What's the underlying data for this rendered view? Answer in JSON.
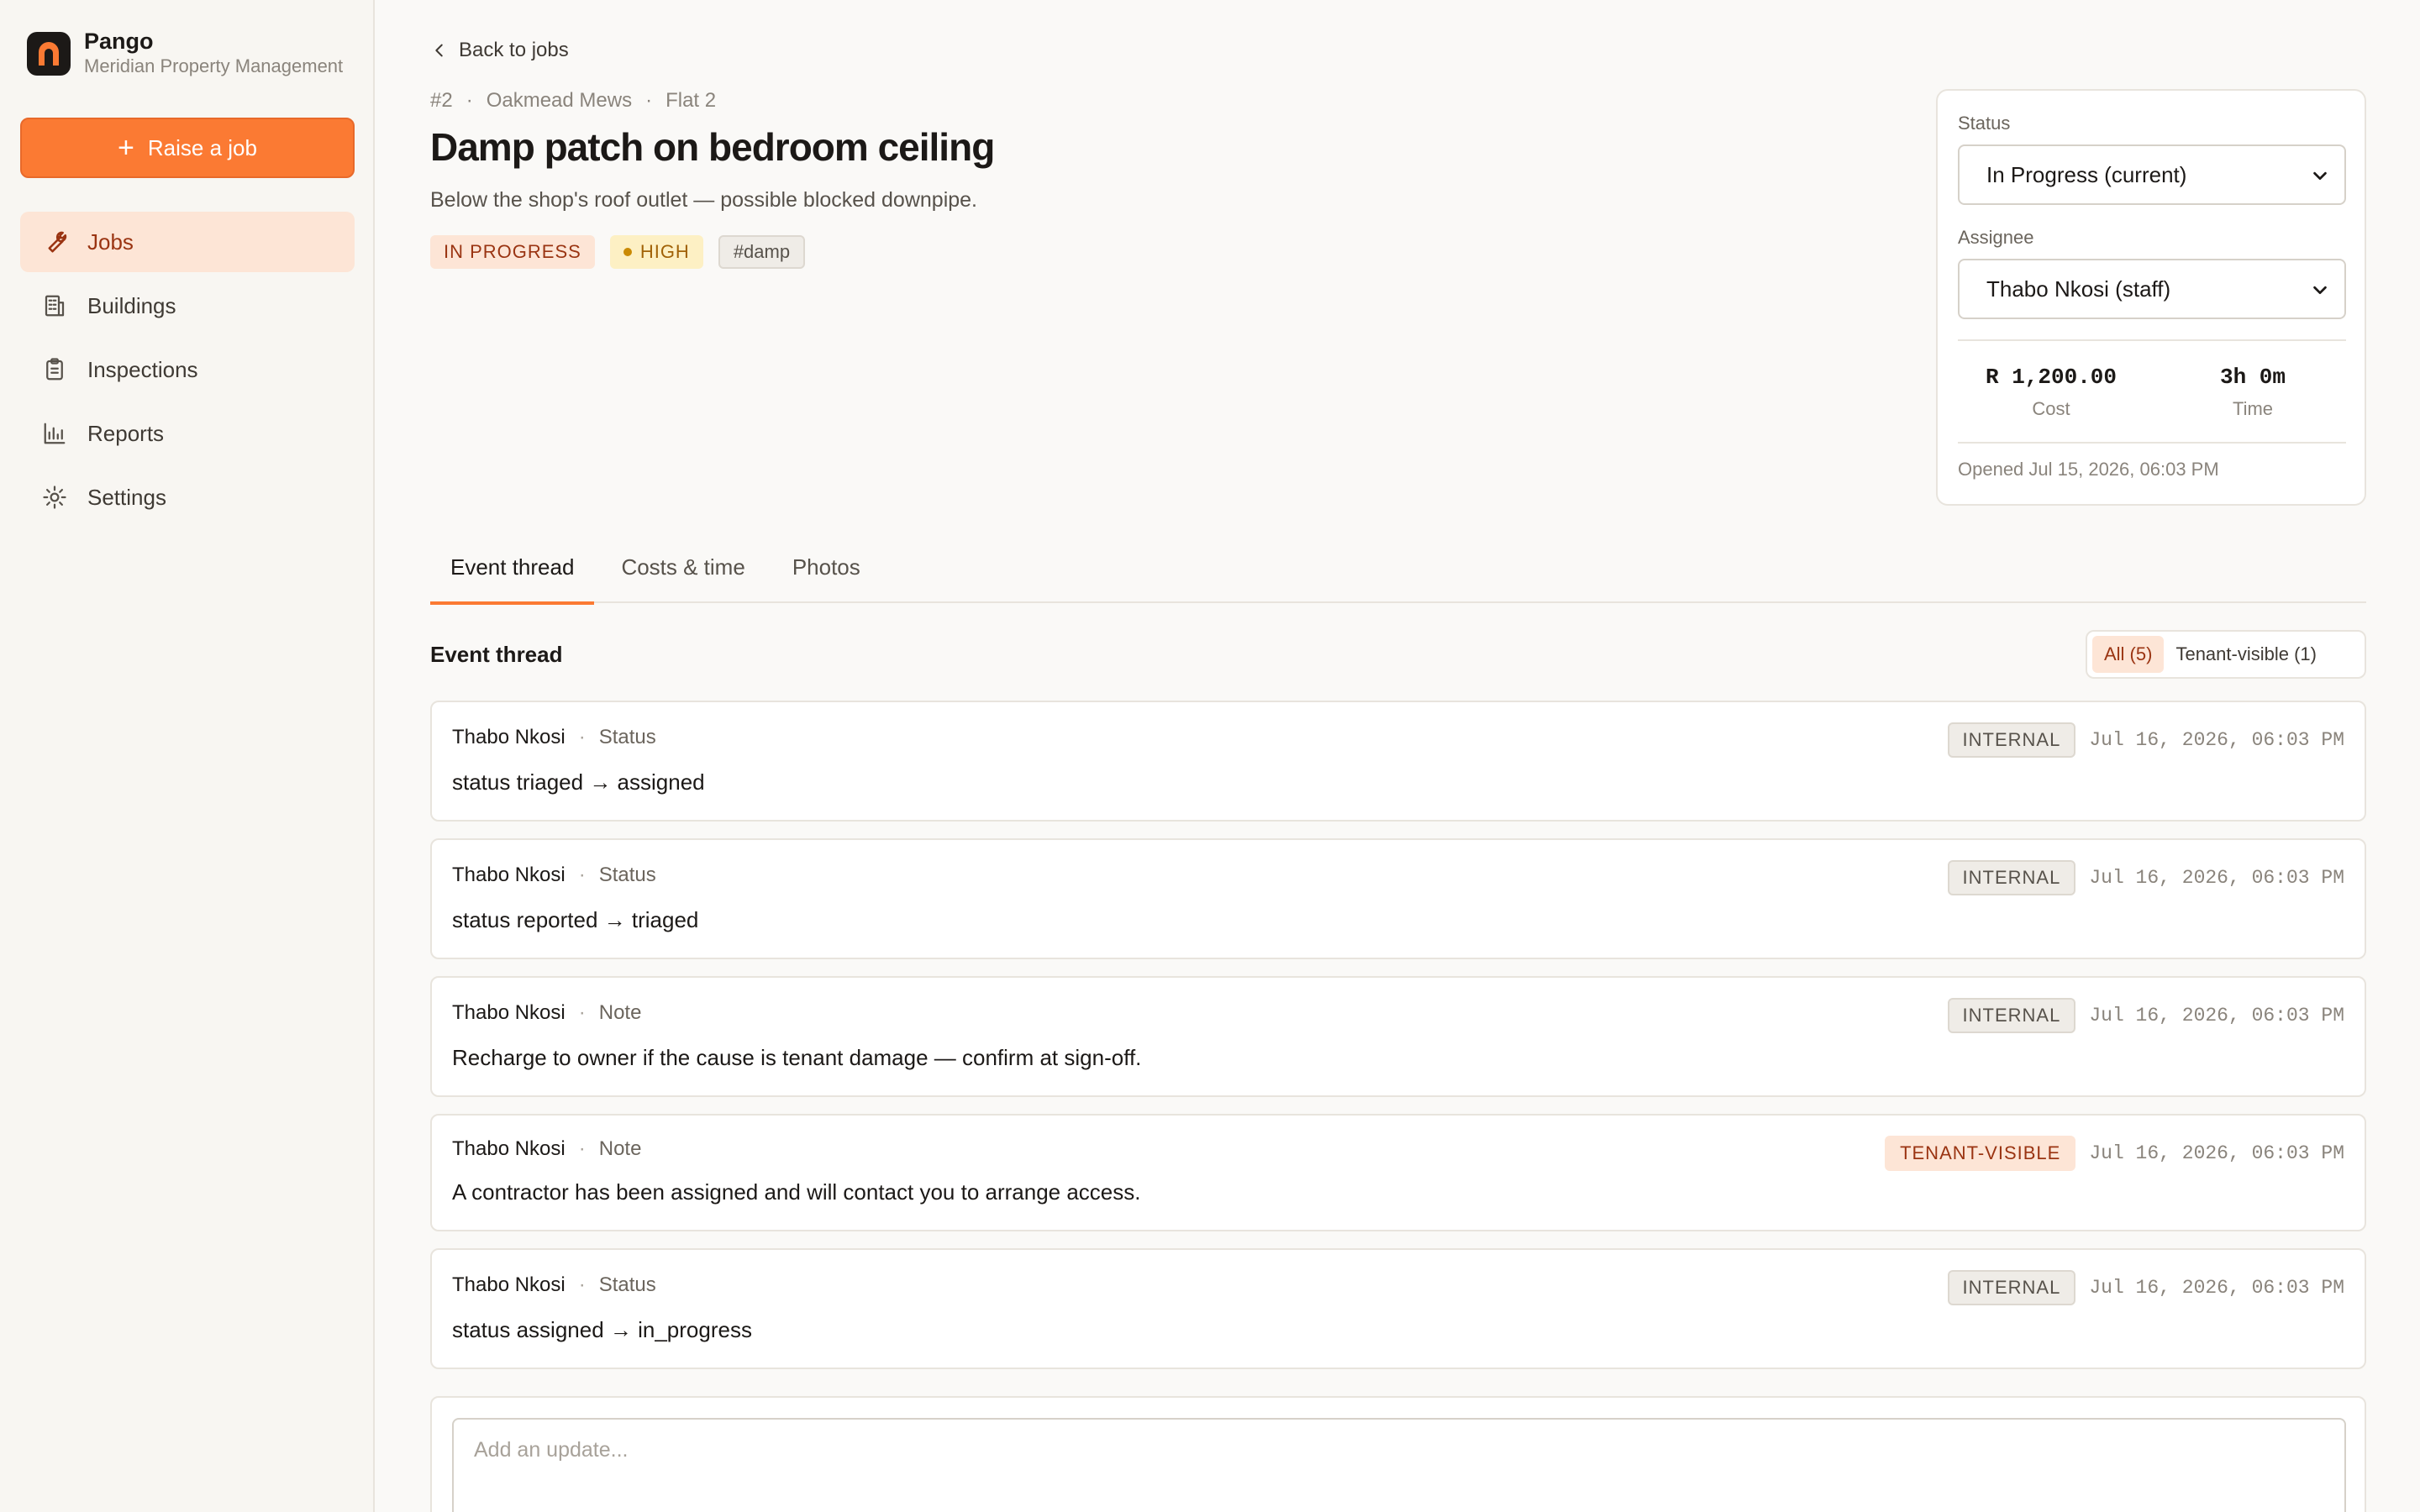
{
  "brand": {
    "name": "Pango",
    "org": "Meridian Property Management"
  },
  "sidebar": {
    "raise_label": "Raise a job",
    "items": [
      {
        "label": "Jobs",
        "icon": "wrench-icon",
        "active": true
      },
      {
        "label": "Buildings",
        "icon": "building-icon"
      },
      {
        "label": "Inspections",
        "icon": "clipboard-icon"
      },
      {
        "label": "Reports",
        "icon": "bar-chart-icon"
      },
      {
        "label": "Settings",
        "icon": "gear-icon"
      }
    ]
  },
  "job": {
    "back_label": "Back to jobs",
    "number": "#2",
    "building": "Oakmead Mews",
    "unit": "Flat 2",
    "title": "Damp patch on bedroom ceiling",
    "description": "Below the shop's roof outlet — possible blocked downpipe.",
    "status_tag": "IN PROGRESS",
    "priority_tag": "HIGH",
    "label_tag": "#damp"
  },
  "side_card": {
    "status_label": "Status",
    "status_value": "In Progress (current)",
    "assignee_label": "Assignee",
    "assignee_value": "Thabo Nkosi (staff)",
    "cost_value": "R 1,200.00",
    "cost_label": "Cost",
    "time_value": "3h 0m",
    "time_label": "Time",
    "opened": "Opened Jul 15, 2026, 06:03 PM"
  },
  "tabs": [
    {
      "label": "Event thread",
      "active": true
    },
    {
      "label": "Costs & time"
    },
    {
      "label": "Photos"
    }
  ],
  "thread": {
    "heading": "Event thread",
    "filter_all": "All (5)",
    "filter_tenant": "Tenant-visible (1)",
    "events": [
      {
        "author": "Thabo Nkosi",
        "kind": "Status",
        "body": "status triaged → assigned",
        "visibility": "INTERNAL",
        "time": "Jul 16, 2026, 06:03 PM"
      },
      {
        "author": "Thabo Nkosi",
        "kind": "Status",
        "body": "status reported → triaged",
        "visibility": "INTERNAL",
        "time": "Jul 16, 2026, 06:03 PM"
      },
      {
        "author": "Thabo Nkosi",
        "kind": "Note",
        "body": "Recharge to owner if the cause is tenant damage — confirm at sign-off.",
        "visibility": "INTERNAL",
        "time": "Jul 16, 2026, 06:03 PM"
      },
      {
        "author": "Thabo Nkosi",
        "kind": "Note",
        "body": "A contractor has been assigned and will contact you to arrange access.",
        "visibility": "TENANT-VISIBLE",
        "time": "Jul 16, 2026, 06:03 PM"
      },
      {
        "author": "Thabo Nkosi",
        "kind": "Status",
        "body": "status assigned → in_progress",
        "visibility": "INTERNAL",
        "time": "Jul 16, 2026, 06:03 PM"
      }
    ]
  },
  "composer": {
    "placeholder": "Add an update..."
  },
  "colors": {
    "accent": "#fb7a33",
    "accent_soft": "#fde5d6",
    "priority": "#ca8a04"
  }
}
